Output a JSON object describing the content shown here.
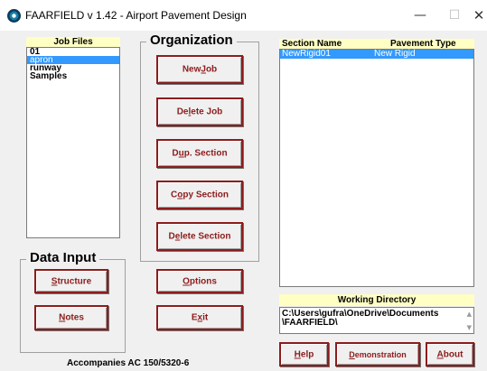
{
  "window": {
    "title": "FAARFIELD v 1.42 - Airport Pavement Design",
    "minimize_glyph": "—",
    "maximize_glyph": "☐",
    "close_glyph": "✕"
  },
  "job_files": {
    "header": "Job Files",
    "items": [
      {
        "label": "01",
        "selected": false
      },
      {
        "label": "apron",
        "selected": true
      },
      {
        "label": "runway",
        "selected": false
      },
      {
        "label": "Samples",
        "selected": false
      }
    ]
  },
  "organization": {
    "title": "Organization",
    "buttons": {
      "new_job": {
        "pre": "New ",
        "accel": "J",
        "post": "ob"
      },
      "delete_job": {
        "pre": "De",
        "accel": "l",
        "post": "ete Job"
      },
      "dup_section": {
        "pre": "D",
        "accel": "u",
        "post": "p. Section"
      },
      "copy_section": {
        "pre": "C",
        "accel": "o",
        "post": "py Section"
      },
      "delete_section": {
        "pre": "D",
        "accel": "e",
        "post": "lete Section"
      }
    }
  },
  "data_input": {
    "title": "Data Input",
    "buttons": {
      "structure": {
        "pre": "",
        "accel": "S",
        "post": "tructure"
      },
      "notes": {
        "pre": "",
        "accel": "N",
        "post": "otes"
      }
    }
  },
  "misc_buttons": {
    "options": {
      "pre": "",
      "accel": "O",
      "post": "ptions"
    },
    "exit": {
      "pre": "E",
      "accel": "x",
      "post": "it"
    }
  },
  "sections": {
    "col_name": "Section Name",
    "col_type": "Pavement Type",
    "rows": [
      {
        "name": "NewRigid01",
        "type": "New Rigid",
        "selected": true
      }
    ]
  },
  "working_directory": {
    "header": "Working Directory",
    "line1": "C:\\Users\\gufra\\OneDrive\\Documents",
    "line2": "\\FAARFIELD\\"
  },
  "bottom_buttons": {
    "help": {
      "pre": "",
      "accel": "H",
      "post": "elp"
    },
    "demonstration": {
      "pre": "",
      "accel": "D",
      "post": "emonstration"
    },
    "about": {
      "pre": "",
      "accel": "A",
      "post": "bout"
    }
  },
  "footer": "Accompanies AC 150/5320-6"
}
